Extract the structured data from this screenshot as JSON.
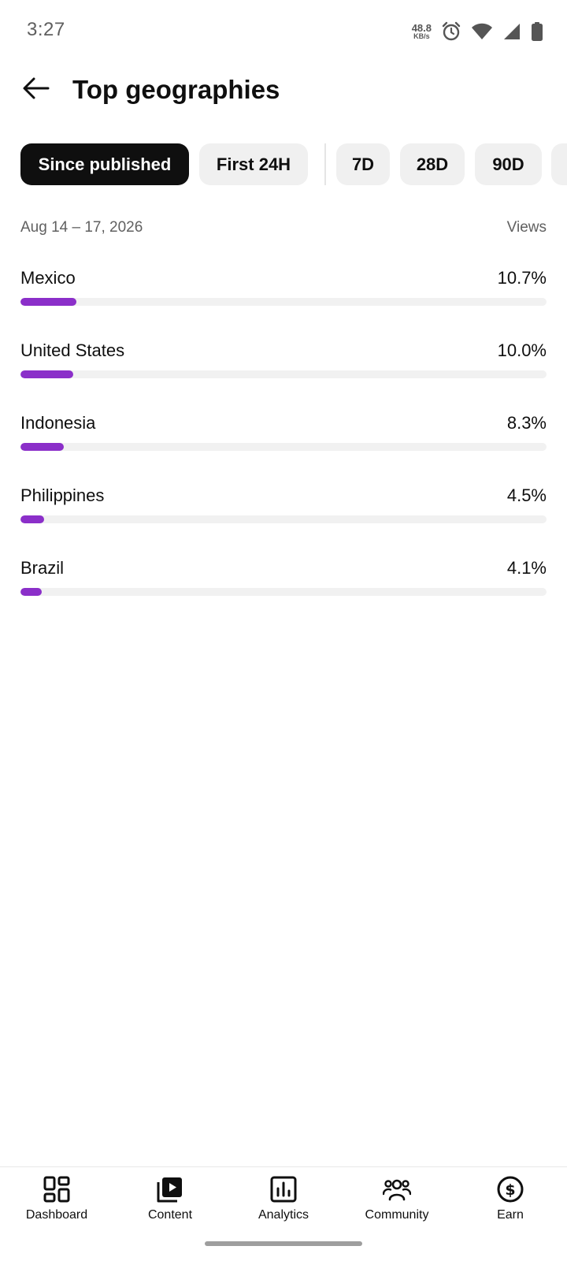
{
  "status_bar": {
    "time": "3:27",
    "net_speed_value": "48.8",
    "net_speed_unit": "KB/s",
    "icons": [
      "alarm-icon",
      "wifi-icon",
      "cell-signal-icon",
      "battery-icon"
    ]
  },
  "header": {
    "back_icon": "back-arrow-icon",
    "title": "Top geographies"
  },
  "filters": {
    "chips": [
      "Since published",
      "First 24H",
      "7D",
      "28D",
      "90D"
    ],
    "selected": "Since published"
  },
  "meta": {
    "date_range": "Aug 14 – 17, 2026",
    "metric": "Views"
  },
  "geographies": [
    {
      "name": "Mexico",
      "percent_label": "10.7%",
      "share": 10.7
    },
    {
      "name": "United States",
      "percent_label": "10.0%",
      "share": 10.0
    },
    {
      "name": "Indonesia",
      "percent_label": "8.3%",
      "share": 8.3
    },
    {
      "name": "Philippines",
      "percent_label": "4.5%",
      "share": 4.5
    },
    {
      "name": "Brazil",
      "percent_label": "4.1%",
      "share": 4.1
    }
  ],
  "bottom_nav": [
    {
      "label": "Dashboard",
      "icon": "dashboard-icon"
    },
    {
      "label": "Content",
      "icon": "content-icon"
    },
    {
      "label": "Analytics",
      "icon": "analytics-icon"
    },
    {
      "label": "Community",
      "icon": "community-icon"
    },
    {
      "label": "Earn",
      "icon": "earn-icon"
    }
  ],
  "colors": {
    "accent_bar": "#8b2fc9",
    "selected_chip": "#0f0f0f",
    "chip_bg": "#f0f0f0"
  }
}
